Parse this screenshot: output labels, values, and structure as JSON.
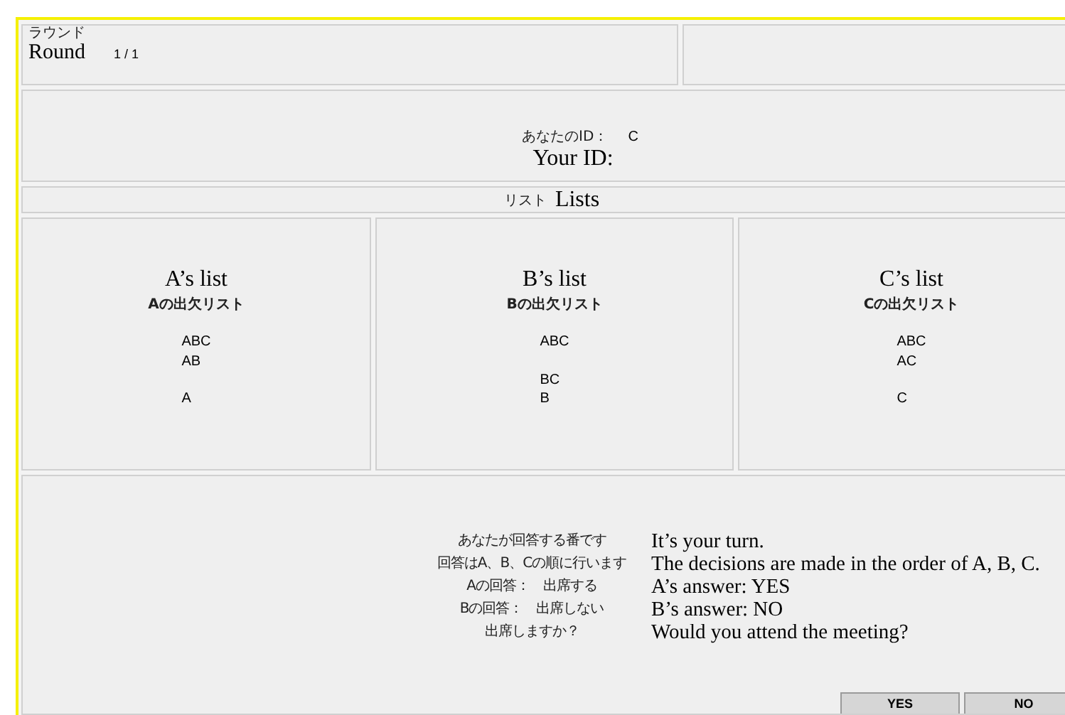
{
  "round": {
    "label_ja": "ラウンド",
    "label": "Round",
    "value": "1 / 1"
  },
  "your_id": {
    "label_ja": "あなたのID：",
    "value": "C",
    "label": "Your ID:"
  },
  "lists_header": {
    "label_ja": "リスト",
    "label": "Lists"
  },
  "lists": [
    {
      "title": "A’s list",
      "title_ja": "Aの出欠リスト",
      "groups": [
        [
          "ABC",
          "AB"
        ],
        [
          "A"
        ]
      ]
    },
    {
      "title": "B’s list",
      "title_ja": "Bの出欠リスト",
      "groups": [
        [
          "ABC"
        ],
        [
          "BC",
          "B"
        ]
      ]
    },
    {
      "title": "C’s list",
      "title_ja": "Cの出欠リスト",
      "groups": [
        [
          "ABC",
          "AC"
        ],
        [
          "C"
        ]
      ]
    }
  ],
  "messages": [
    {
      "ja": "あなたが回答する番です",
      "en": "It’s your turn."
    },
    {
      "ja": "回答はA、B、Cの順に行います",
      "en": "The decisions are made in the order of A, B, C."
    },
    {
      "ja": "Aの回答：　出席する",
      "en": "A’s answer: YES"
    },
    {
      "ja": "Bの回答：　出席しない",
      "en": "B’s answer: NO"
    },
    {
      "ja": "出席しますか？",
      "en": "Would you attend the meeting?"
    }
  ],
  "buttons": [
    "YES",
    "NO"
  ]
}
